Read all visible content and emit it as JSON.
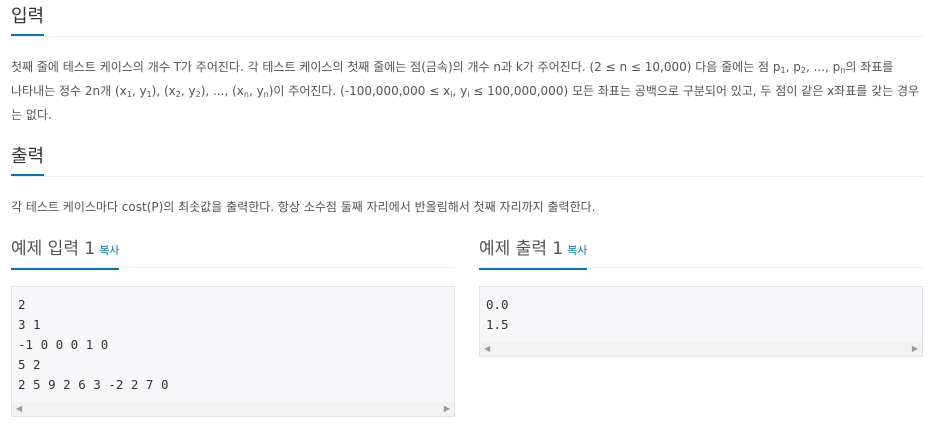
{
  "input_section": {
    "title": "입력",
    "line1_a": "첫째 줄에 테스트 케이스의 개수 T가 주어진다. 각 테스트 케이스의 첫째 줄에는 점(금속)의 개수 n과 k가 주어진다. (2 ≤ n ≤ 10,000) 다음 줄에는 점 p",
    "s1": "1",
    "c1": ", p",
    "s2": "2",
    "c2": ", ..., p",
    "sn": "n",
    "line1_b": "의 좌표를",
    "line2_a": "나타내는 정수 2n개 (x",
    "x1": "1",
    "y1_pre": ", y",
    "y1": "1",
    "mid1": "), (x",
    "x2": "2",
    "y2_pre": ", y",
    "y2": "2",
    "mid2": "), ..., (x",
    "xn": "n",
    "yn_pre": ", y",
    "yn": "n",
    "line2_b": ")이 주어진다. (-100,000,000 ≤ x",
    "xi": "i",
    "yi_pre": ", y",
    "yi": "i",
    "line2_c": " ≤ 100,000,000) 모든 좌표는 공백으로 구분되어 있고, 두 점이 같은 x좌표를 갖는 경우",
    "line3": "는 없다."
  },
  "output_section": {
    "title": "출력",
    "text": "각 테스트 케이스마다 cost(P)의 최솟값을 출력한다. 항상 소수점 둘째 자리에서 반올림해서 첫째 자리까지 출력한다."
  },
  "example_input": {
    "title": "예제 입력 1",
    "copy": "복사",
    "content": "2\n3 1\n-1 0 0 0 1 0\n5 2\n2 5 9 2 6 3 -2 2 7 0"
  },
  "example_output": {
    "title": "예제 출력 1",
    "copy": "복사",
    "content": "0.0\n1.5"
  }
}
